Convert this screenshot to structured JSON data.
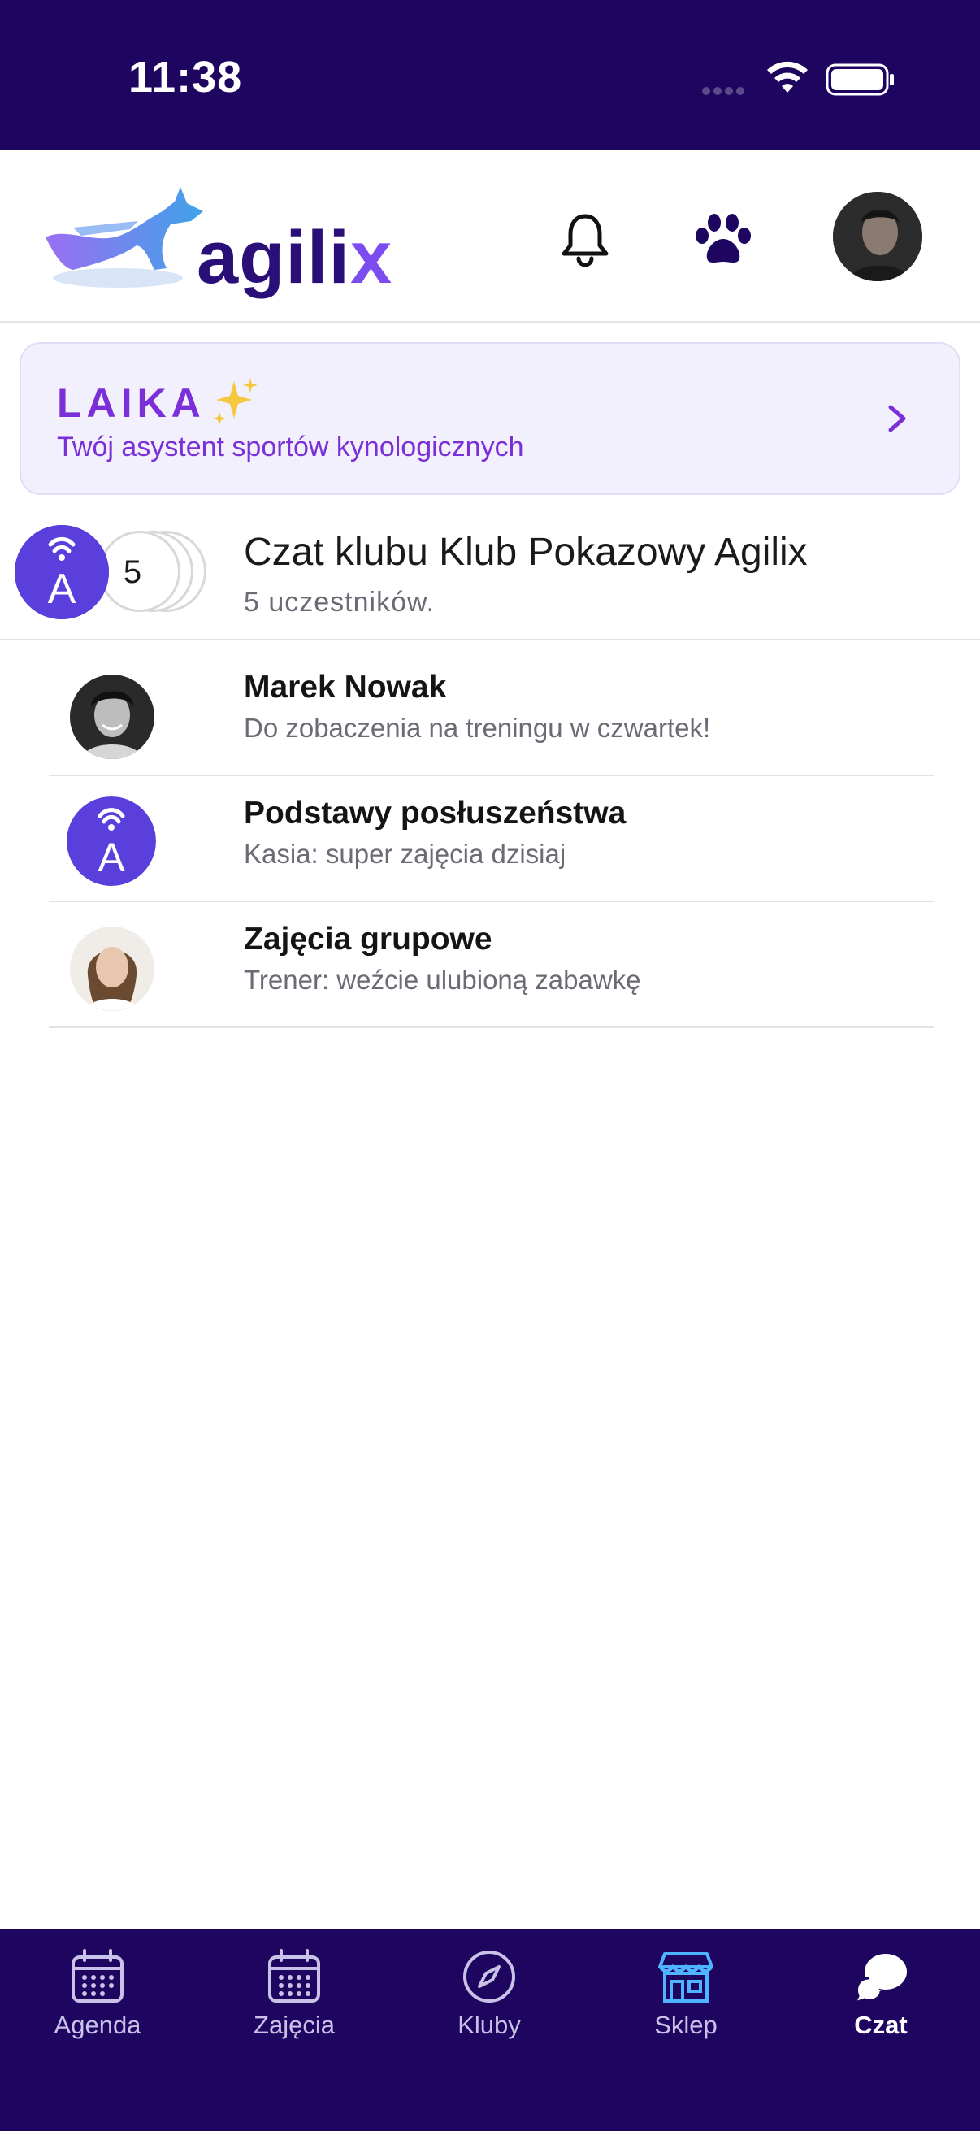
{
  "status_bar": {
    "time": "11:38"
  },
  "header": {
    "logo_text_main": "agili",
    "logo_text_accent": "x"
  },
  "laika": {
    "title": "LAIKA",
    "subtitle": "Twój asystent sportów kynologicznych"
  },
  "club_chat": {
    "avatar_letter": "A",
    "participant_count": "5",
    "title": "Czat klubu Klub Pokazowy Agilix",
    "subtitle": "5 uczestników."
  },
  "chats": [
    {
      "name": "Marek Nowak",
      "message": "Do zobaczenia na treningu w czwartek!"
    },
    {
      "name": "Podstawy posłuszeństwa",
      "message": "Kasia: super zajęcia dzisiaj",
      "avatar_letter": "A"
    },
    {
      "name": "Zajęcia grupowe",
      "message": "Trener: weźcie ulubioną zabawkę"
    }
  ],
  "tabs": [
    {
      "label": "Agenda",
      "icon": "calendar-icon"
    },
    {
      "label": "Zajęcia",
      "icon": "calendar-grid-icon"
    },
    {
      "label": "Kluby",
      "icon": "compass-icon"
    },
    {
      "label": "Sklep",
      "icon": "store-icon"
    },
    {
      "label": "Czat",
      "icon": "chat-bubble-icon",
      "active": true
    }
  ],
  "colors": {
    "brand_dark": "#1e0660",
    "brand_purple": "#7a2fd8",
    "club_avatar": "#5a3fdc",
    "store_icon": "#4fb3ff"
  }
}
